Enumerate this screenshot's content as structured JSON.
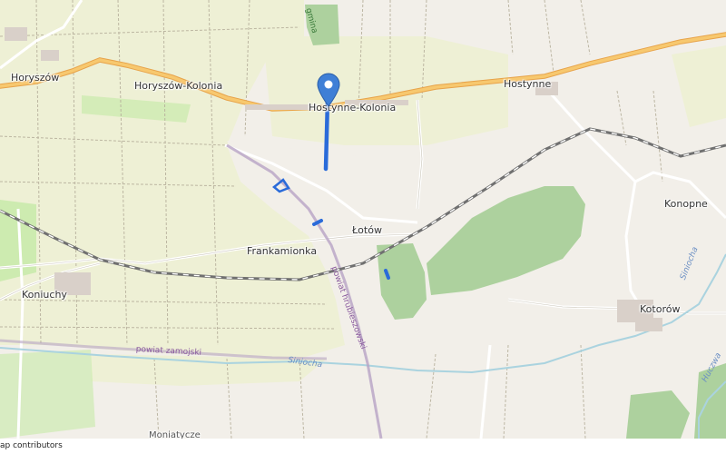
{
  "map": {
    "places": {
      "horyszow": "Horyszów",
      "horyszow_kolonia": "Horyszów-Kolonia",
      "hostynne_kolonia": "Hostynne-Kolonia",
      "hostynne": "Hostynne",
      "konopne": "Konopne",
      "lotow": "Łotów",
      "frankamionka": "Frankamionka",
      "koniuchy": "Koniuchy",
      "kotorow": "Kotorów",
      "moniatycze": "Moniatycze"
    },
    "boundaries": {
      "powiat_hrubieszowski": "powiat hrubieszowski",
      "powiat_zamojski": "powiat zamojski",
      "gmina": "gmina"
    },
    "rivers": {
      "siniocha": "Siniocha",
      "siniocha_2": "Siniocha",
      "huczwa": "Huczwa"
    },
    "marker_icon": "map-pin-icon",
    "colors": {
      "marker": "#3f7fd6",
      "route": "#2a6bd9",
      "forest": "#add19e",
      "farmland": "#eef0d5",
      "main_road": "#f7c86f",
      "railway": "#707070",
      "water": "#aad3df"
    }
  },
  "attribution": "ap contributors"
}
